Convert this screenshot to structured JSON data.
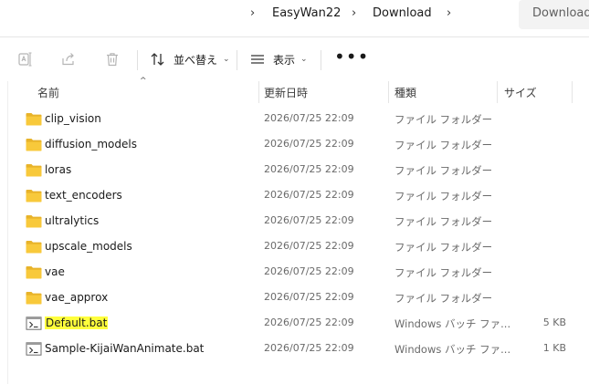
{
  "breadcrumb": {
    "items": [
      "EasyWan22",
      "Download"
    ],
    "search_placeholder": "Download"
  },
  "commands": {
    "sort_label": "並べ替え",
    "view_label": "表示",
    "more_label": "•••"
  },
  "columns": {
    "name": "名前",
    "date": "更新日時",
    "type": "種類",
    "size": "サイズ"
  },
  "files": [
    {
      "name": "clip_vision",
      "date": "2026/07/25 22:09",
      "type": "ファイル フォルダー",
      "size": "",
      "kind": "folder"
    },
    {
      "name": "diffusion_models",
      "date": "2026/07/25 22:09",
      "type": "ファイル フォルダー",
      "size": "",
      "kind": "folder"
    },
    {
      "name": "loras",
      "date": "2026/07/25 22:09",
      "type": "ファイル フォルダー",
      "size": "",
      "kind": "folder"
    },
    {
      "name": "text_encoders",
      "date": "2026/07/25 22:09",
      "type": "ファイル フォルダー",
      "size": "",
      "kind": "folder"
    },
    {
      "name": "ultralytics",
      "date": "2026/07/25 22:09",
      "type": "ファイル フォルダー",
      "size": "",
      "kind": "folder"
    },
    {
      "name": "upscale_models",
      "date": "2026/07/25 22:09",
      "type": "ファイル フォルダー",
      "size": "",
      "kind": "folder"
    },
    {
      "name": "vae",
      "date": "2026/07/25 22:09",
      "type": "ファイル フォルダー",
      "size": "",
      "kind": "folder"
    },
    {
      "name": "vae_approx",
      "date": "2026/07/25 22:09",
      "type": "ファイル フォルダー",
      "size": "",
      "kind": "folder"
    },
    {
      "name": "Default.bat",
      "date": "2026/07/25 22:09",
      "type": "Windows バッチ ファ...",
      "size": "5 KB",
      "kind": "bat",
      "highlighted": true
    },
    {
      "name": "Sample-KijaiWanAnimate.bat",
      "date": "2026/07/25 22:09",
      "type": "Windows バッチ ファ...",
      "size": "1 KB",
      "kind": "bat"
    }
  ],
  "colors": {
    "folder_yellow": "#f8c93b",
    "highlight": "#ffff3c"
  }
}
